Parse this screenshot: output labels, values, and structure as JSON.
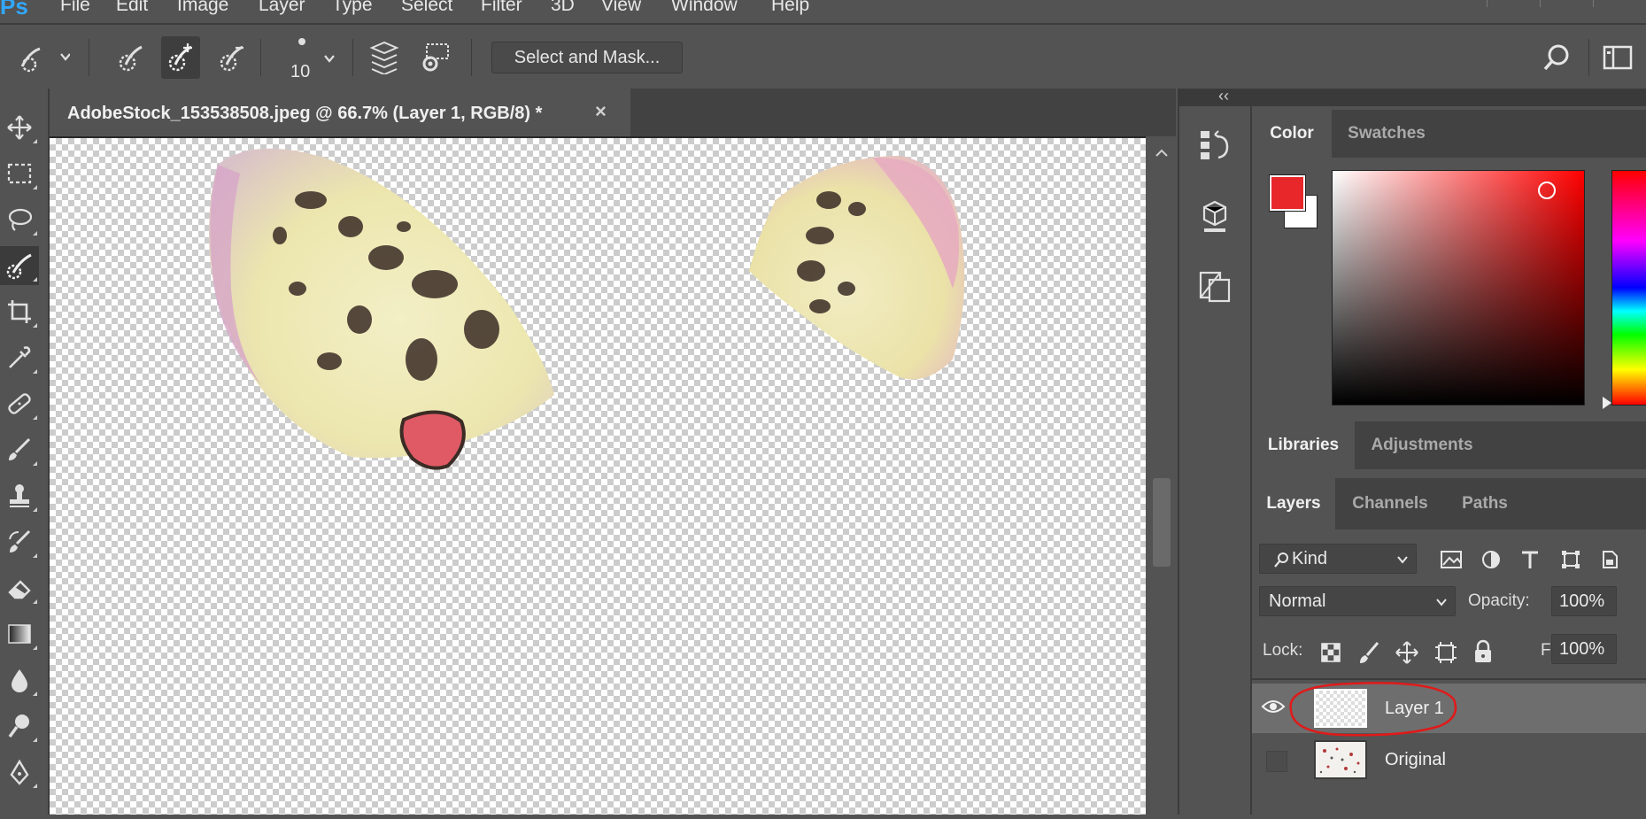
{
  "app": {
    "logo": "Ps"
  },
  "menu": [
    "File",
    "Edit",
    "Image",
    "Layer",
    "Type",
    "Select",
    "Filter",
    "3D",
    "View",
    "Window",
    "Help"
  ],
  "options_bar": {
    "brush_size": "10",
    "select_and_mask": "Select and Mask..."
  },
  "document": {
    "tab_title": "AdobeStock_153538508.jpeg @ 66.7% (Layer 1, RGB/8) *",
    "close_glyph": "×",
    "zoom": "66.7%"
  },
  "collapse_glyph": "‹‹",
  "color_panel": {
    "tabs": [
      "Color",
      "Swatches"
    ],
    "active_tab": "Color",
    "foreground": "#e8272a",
    "background": "#ffffff",
    "hue_color": "#ff0000"
  },
  "libraries_panel": {
    "tabs": [
      "Libraries",
      "Adjustments"
    ],
    "active_tab": "Libraries"
  },
  "layers_panel": {
    "tabs": [
      "Layers",
      "Channels",
      "Paths"
    ],
    "active_tab": "Layers",
    "filter_kind": "Kind",
    "blend_mode": "Normal",
    "opacity_label": "Opacity:",
    "opacity_value": "100%",
    "lock_label": "Lock:",
    "fill_label": "Fill:",
    "fill_value": "100%",
    "layers": [
      {
        "name": "Layer 1",
        "visible": true,
        "selected": true,
        "highlighted": true
      },
      {
        "name": "Original",
        "visible": false,
        "selected": false,
        "highlighted": false
      }
    ]
  },
  "colors": {
    "annotation_circle": "#e01a1a",
    "app_bg": "#535353",
    "panel_dark": "#424242"
  }
}
